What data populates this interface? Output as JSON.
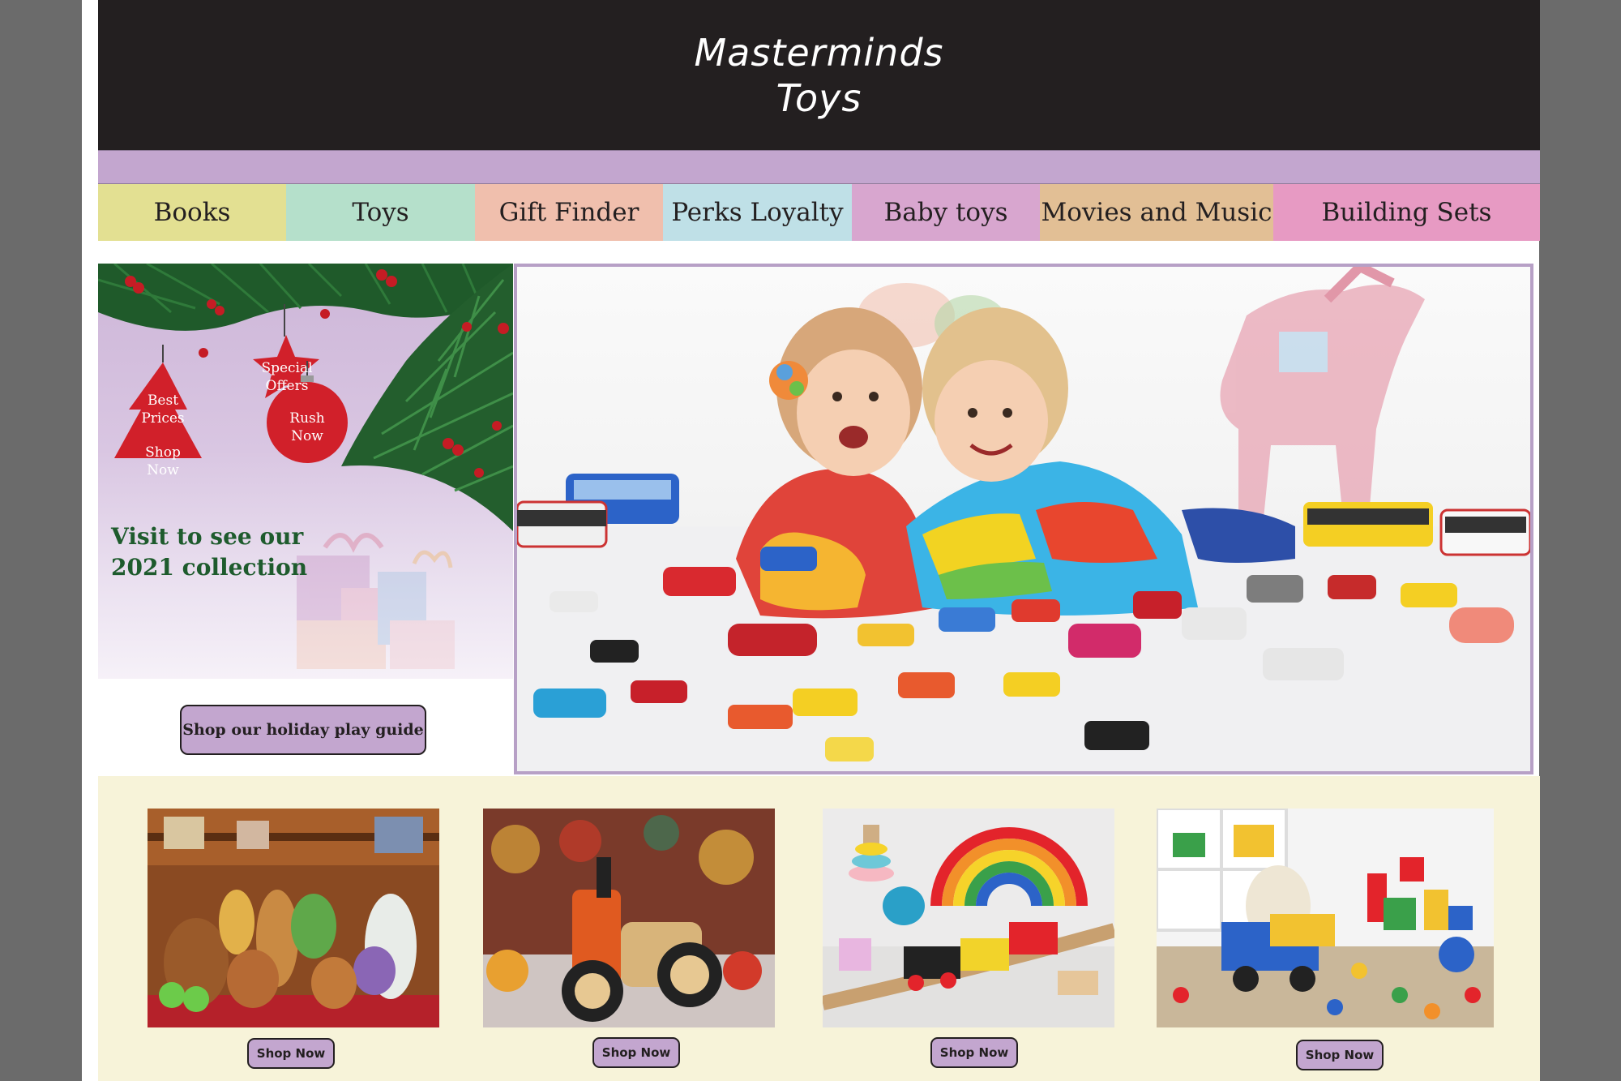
{
  "brand": {
    "line1": "Masterminds",
    "line2": "Toys"
  },
  "nav": [
    {
      "label": "Books",
      "color": "#e3e092"
    },
    {
      "label": "Toys",
      "color": "#b5e0cb"
    },
    {
      "label": "Gift Finder",
      "color": "#f0bfad"
    },
    {
      "label": "Perks Loyalty",
      "color": "#bfe0e7"
    },
    {
      "label": "Baby toys",
      "color": "#d8a6cf"
    },
    {
      "label": "Movies and Music",
      "color": "#e2bf95"
    },
    {
      "label": "Building Sets",
      "color": "#e79ac3"
    }
  ],
  "promo": {
    "tag_special": "Special Offers",
    "tag_best": "Best Prices",
    "tag_shop": "Shop Now",
    "tag_rush": "Rush Now",
    "headline_line1": "Visit to see our",
    "headline_line2": "2021 collection",
    "guide_button": "Shop our holiday play guide"
  },
  "products": [
    {
      "label": "Shop Now"
    },
    {
      "label": "Shop Now"
    },
    {
      "label": "Shop Now"
    },
    {
      "label": "Shop Now"
    }
  ],
  "colors": {
    "header_bg": "#231f20",
    "accent_purple": "#c3a6cf",
    "product_strip_bg": "#f7f3d9",
    "ornament_red": "#d1202a",
    "headline_green": "#1e5b2d"
  }
}
